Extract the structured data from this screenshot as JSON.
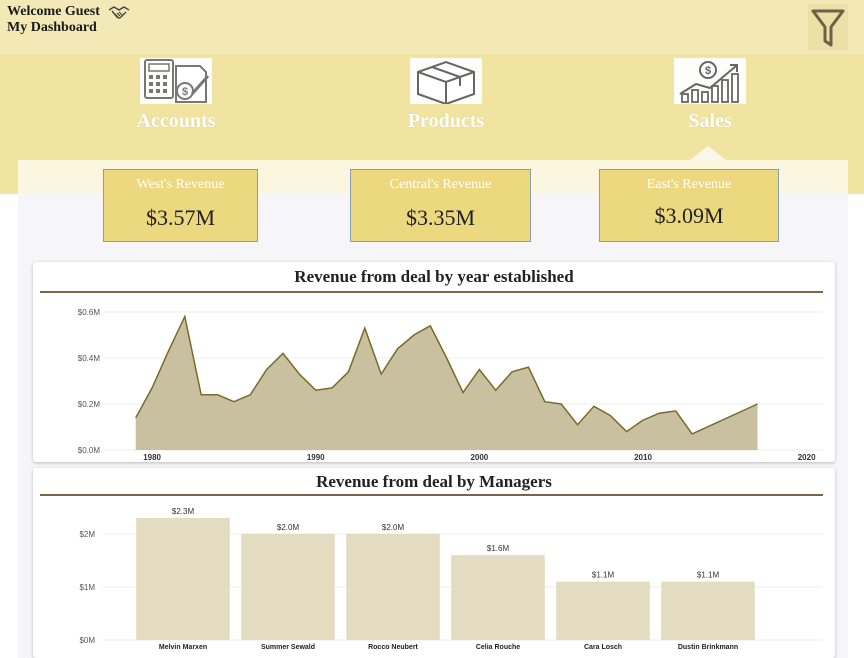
{
  "header": {
    "welcome": "Welcome Guest",
    "dashboard": "My Dashboard",
    "handshake_icon": "handshake-icon",
    "filter_icon": "filter-icon"
  },
  "nav": {
    "items": [
      {
        "label": "Accounts",
        "icon": "calculator-document-icon"
      },
      {
        "label": "Products",
        "icon": "box-icon"
      },
      {
        "label": "Sales",
        "icon": "sales-growth-icon"
      }
    ],
    "active": "Sales"
  },
  "kpis": [
    {
      "title": "West's Revenue",
      "value": "$3.57M"
    },
    {
      "title": "Central's Revenue",
      "value": "$3.35M"
    },
    {
      "title": "East's Revenue",
      "value": "$3.09M"
    }
  ],
  "colors": {
    "band": "#f0e4a0",
    "card": "#ecd87f",
    "area_fill": "#c9c0a0",
    "area_line": "#7a6a2a",
    "bar_fill": "#e3dcc0",
    "rule": "#7a6548"
  },
  "chart_data": [
    {
      "type": "area",
      "title": "Revenue from deal by year established",
      "xlabel": "",
      "ylabel": "",
      "xlim": [
        1977,
        2021
      ],
      "ylim": [
        0,
        0.6
      ],
      "x_ticks": [
        1980,
        1990,
        2000,
        2010,
        2020
      ],
      "y_ticks": [
        {
          "value": 0,
          "label": "$0.0M"
        },
        {
          "value": 0.2,
          "label": "$0.2M"
        },
        {
          "value": 0.4,
          "label": "$0.4M"
        },
        {
          "value": 0.6,
          "label": "$0.6M"
        }
      ],
      "x": [
        1979,
        1980,
        1981,
        1982,
        1983,
        1984,
        1985,
        1986,
        1987,
        1988,
        1989,
        1990,
        1991,
        1992,
        1993,
        1994,
        1995,
        1996,
        1997,
        1998,
        1999,
        2000,
        2001,
        2002,
        2003,
        2004,
        2005,
        2006,
        2007,
        2008,
        2009,
        2010,
        2011,
        2012,
        2013,
        2017
      ],
      "y": [
        0.14,
        0.27,
        0.43,
        0.58,
        0.24,
        0.24,
        0.21,
        0.24,
        0.35,
        0.42,
        0.33,
        0.26,
        0.27,
        0.34,
        0.53,
        0.33,
        0.44,
        0.5,
        0.54,
        0.4,
        0.25,
        0.35,
        0.26,
        0.34,
        0.36,
        0.21,
        0.2,
        0.11,
        0.19,
        0.15,
        0.08,
        0.13,
        0.16,
        0.17,
        0.07,
        0.2
      ]
    },
    {
      "type": "bar",
      "title": "Revenue from deal by Managers",
      "xlabel": "",
      "ylabel": "",
      "ylim": [
        0,
        2.3
      ],
      "y_ticks": [
        {
          "value": 0,
          "label": "$0M"
        },
        {
          "value": 1,
          "label": "$1M"
        },
        {
          "value": 2,
          "label": "$2M"
        }
      ],
      "categories": [
        "Melvin Marxen",
        "Summer Sewald",
        "Rocco Neubert",
        "Celia Rouche",
        "Cara Losch",
        "Dustin Brinkmann"
      ],
      "values": [
        2.3,
        2.0,
        2.0,
        1.6,
        1.1,
        1.1
      ],
      "data_labels": [
        "$2.3M",
        "$2.0M",
        "$2.0M",
        "$1.6M",
        "$1.1M",
        "$1.1M"
      ]
    }
  ]
}
